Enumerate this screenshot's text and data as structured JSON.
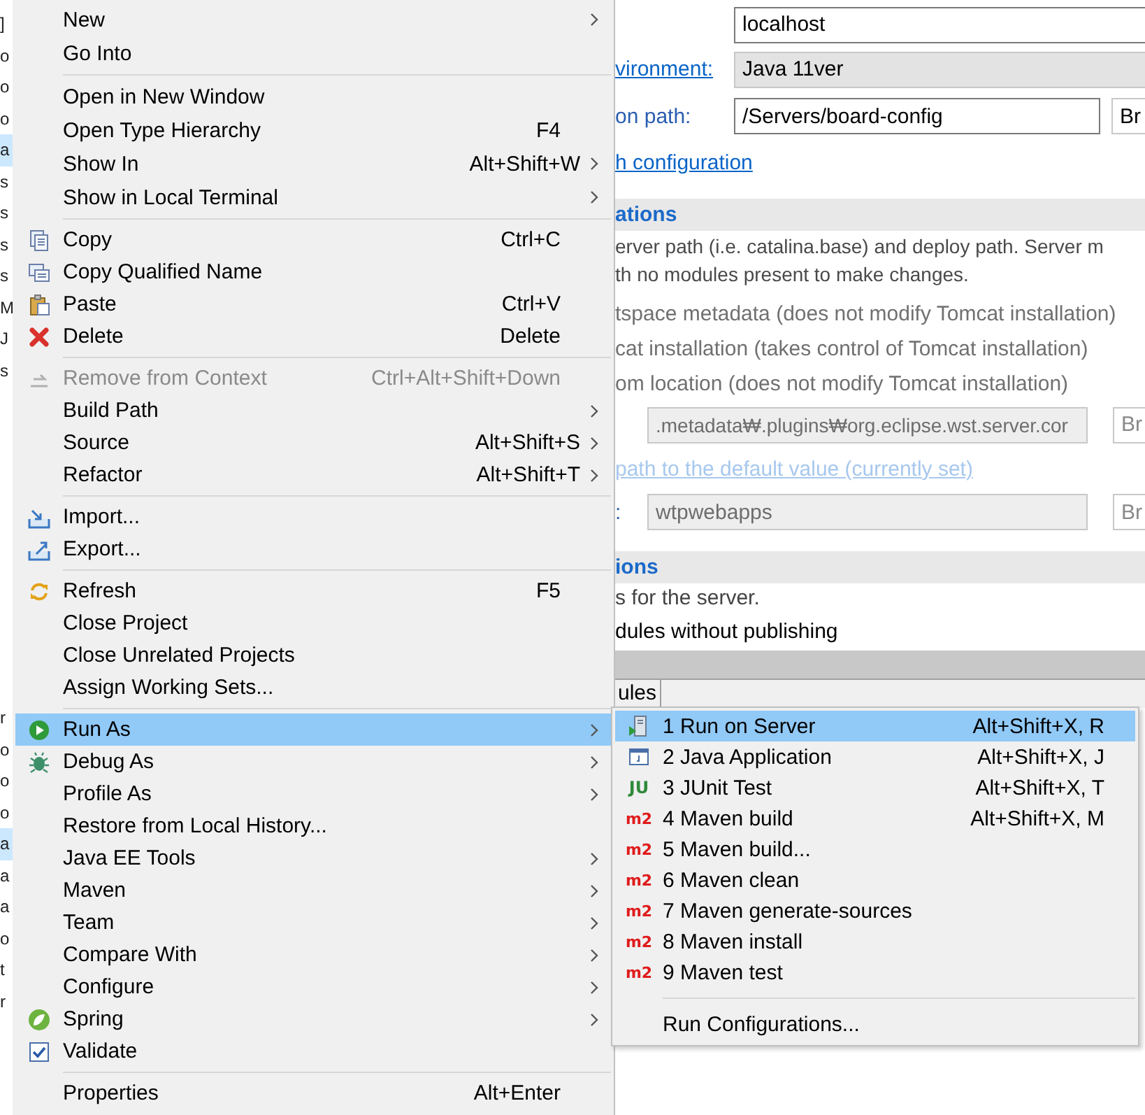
{
  "left_strip": {
    "items": [
      {
        "label": "]",
        "selected": false
      },
      {
        "label": "o",
        "selected": false
      },
      {
        "label": "o",
        "selected": false
      },
      {
        "label": "o",
        "selected": false
      },
      {
        "label": "a",
        "selected": true
      },
      {
        "label": "s",
        "selected": false
      },
      {
        "label": "s",
        "selected": false
      },
      {
        "label": "s",
        "selected": false
      },
      {
        "label": "s",
        "selected": false
      },
      {
        "label": "M",
        "selected": false
      },
      {
        "label": "J",
        "selected": false
      },
      {
        "label": "s",
        "selected": false
      }
    ],
    "lower_items": [
      {
        "label": "r",
        "selected": false
      },
      {
        "label": "o",
        "selected": false
      },
      {
        "label": "o",
        "selected": false
      },
      {
        "label": "o",
        "selected": false
      },
      {
        "label": "a",
        "selected": true
      },
      {
        "label": "a",
        "selected": false
      },
      {
        "label": "a",
        "selected": false
      },
      {
        "label": "o",
        "selected": false
      },
      {
        "label": "t",
        "selected": false
      },
      {
        "label": "r",
        "selected": false
      }
    ]
  },
  "server_form": {
    "host_value": "localhost",
    "runtime_link": "vironment:",
    "runtime_value": "Java 11ver",
    "config_label": "on path:",
    "config_value": "/Servers/board-config",
    "config_button": "Br",
    "switch_link": "h configuration"
  },
  "locations_section": {
    "title": "ations",
    "description": [
      "erver path (i.e. catalina.base) and deploy path. Server m",
      "th no modules present to make changes."
    ],
    "options": [
      {
        "label": "tspace metadata (does not modify Tomcat installation)",
        "disabled": true
      },
      {
        "label": "cat installation (takes control of Tomcat installation)",
        "disabled": true
      },
      {
        "label": "om location (does not modify Tomcat installation)",
        "disabled": true
      }
    ],
    "server_path": {
      "value": ".metadata₩.plugins₩org.eclipse.wst.server.cor",
      "button": "Br",
      "disabled": true
    },
    "reset_link": {
      "label": "path to the default value (currently set)",
      "disabled": true
    },
    "deploy_path": {
      "label": ":",
      "value": "wtpwebapps",
      "button": "Br",
      "disabled": true
    }
  },
  "options_section": {
    "title": "ions",
    "description": "s for the server.",
    "partial_line": "dules without publishing"
  },
  "bottom_tabs": [
    {
      "label": "ules"
    }
  ],
  "menu": {
    "entries": [
      {
        "kind": "item",
        "label": "New",
        "submenu": true,
        "disabled": false,
        "selected": false
      },
      {
        "kind": "item",
        "label": "Go Into",
        "submenu": false,
        "disabled": false,
        "selected": false
      },
      {
        "kind": "separator"
      },
      {
        "kind": "item",
        "label": "Open in New Window",
        "submenu": false,
        "disabled": false,
        "selected": false
      },
      {
        "kind": "item",
        "label": "Open Type Hierarchy",
        "shortcut": "F4",
        "submenu": false,
        "disabled": false,
        "selected": false
      },
      {
        "kind": "item",
        "label": "Show In",
        "shortcut": "Alt+Shift+W",
        "submenu": true,
        "disabled": false,
        "selected": false
      },
      {
        "kind": "item",
        "label": "Show in Local Terminal",
        "submenu": true,
        "disabled": false,
        "selected": false
      },
      {
        "kind": "separator"
      },
      {
        "kind": "item",
        "label": "Copy",
        "shortcut": "Ctrl+C",
        "submenu": false,
        "disabled": false,
        "selected": false
      },
      {
        "kind": "item",
        "label": "Copy Qualified Name",
        "submenu": false,
        "disabled": false,
        "selected": false
      },
      {
        "kind": "item",
        "label": "Paste",
        "shortcut": "Ctrl+V",
        "submenu": false,
        "disabled": false,
        "selected": false
      },
      {
        "kind": "item",
        "label": "Delete",
        "shortcut": "Delete",
        "submenu": false,
        "disabled": false,
        "selected": false
      },
      {
        "kind": "separator"
      },
      {
        "kind": "item",
        "label": "Remove from Context",
        "shortcut": "Ctrl+Alt+Shift+Down",
        "submenu": false,
        "disabled": true,
        "selected": false
      },
      {
        "kind": "item",
        "label": "Build Path",
        "submenu": true,
        "disabled": false,
        "selected": false
      },
      {
        "kind": "item",
        "label": "Source",
        "shortcut": "Alt+Shift+S",
        "submenu": true,
        "disabled": false,
        "selected": false
      },
      {
        "kind": "item",
        "label": "Refactor",
        "shortcut": "Alt+Shift+T",
        "submenu": true,
        "disabled": false,
        "selected": false
      },
      {
        "kind": "separator"
      },
      {
        "kind": "item",
        "label": "Import...",
        "submenu": false,
        "disabled": false,
        "selected": false
      },
      {
        "kind": "item",
        "label": "Export...",
        "submenu": false,
        "disabled": false,
        "selected": false
      },
      {
        "kind": "separator"
      },
      {
        "kind": "item",
        "label": "Refresh",
        "shortcut": "F5",
        "submenu": false,
        "disabled": false,
        "selected": false
      },
      {
        "kind": "item",
        "label": "Close Project",
        "submenu": false,
        "disabled": false,
        "selected": false
      },
      {
        "kind": "item",
        "label": "Close Unrelated Projects",
        "submenu": false,
        "disabled": false,
        "selected": false
      },
      {
        "kind": "item",
        "label": "Assign Working Sets...",
        "submenu": false,
        "disabled": false,
        "selected": false
      },
      {
        "kind": "separator"
      },
      {
        "kind": "item",
        "label": "Run As",
        "submenu": true,
        "disabled": false,
        "selected": true
      },
      {
        "kind": "item",
        "label": "Debug As",
        "submenu": true,
        "disabled": false,
        "selected": false
      },
      {
        "kind": "item",
        "label": "Profile As",
        "submenu": true,
        "disabled": false,
        "selected": false
      },
      {
        "kind": "item",
        "label": "Restore from Local History...",
        "submenu": false,
        "disabled": false,
        "selected": false
      },
      {
        "kind": "item",
        "label": "Java EE Tools",
        "submenu": true,
        "disabled": false,
        "selected": false
      },
      {
        "kind": "item",
        "label": "Maven",
        "submenu": true,
        "disabled": false,
        "selected": false
      },
      {
        "kind": "item",
        "label": "Team",
        "submenu": true,
        "disabled": false,
        "selected": false
      },
      {
        "kind": "item",
        "label": "Compare With",
        "submenu": true,
        "disabled": false,
        "selected": false
      },
      {
        "kind": "item",
        "label": "Configure",
        "submenu": true,
        "disabled": false,
        "selected": false
      },
      {
        "kind": "item",
        "label": "Spring",
        "submenu": true,
        "disabled": false,
        "selected": false
      },
      {
        "kind": "item",
        "label": "Validate",
        "submenu": false,
        "disabled": false,
        "selected": false
      },
      {
        "kind": "separator"
      },
      {
        "kind": "item",
        "label": "Properties",
        "shortcut": "Alt+Enter",
        "submenu": false,
        "disabled": false,
        "selected": false
      }
    ]
  },
  "submenu": {
    "entries": [
      {
        "kind": "item",
        "label": "1 Run on Server",
        "shortcut": "Alt+Shift+X, R",
        "selected": true
      },
      {
        "kind": "item",
        "label": "2 Java Application",
        "shortcut": "Alt+Shift+X, J",
        "selected": false
      },
      {
        "kind": "item",
        "badge": "JU",
        "label": "3 JUnit Test",
        "shortcut": "Alt+Shift+X, T",
        "selected": false
      },
      {
        "kind": "item",
        "badge": "m2",
        "label": "4 Maven build",
        "shortcut": "Alt+Shift+X, M",
        "selected": false
      },
      {
        "kind": "item",
        "badge": "m2",
        "label": "5 Maven build...",
        "selected": false
      },
      {
        "kind": "item",
        "badge": "m2",
        "label": "6 Maven clean",
        "selected": false
      },
      {
        "kind": "item",
        "badge": "m2",
        "label": "7 Maven generate-sources",
        "selected": false
      },
      {
        "kind": "item",
        "badge": "m2",
        "label": "8 Maven install",
        "selected": false
      },
      {
        "kind": "item",
        "badge": "m2",
        "label": "9 Maven test",
        "selected": false
      },
      {
        "kind": "separator"
      },
      {
        "kind": "item",
        "label": "Run Configurations...",
        "selected": false
      }
    ]
  }
}
